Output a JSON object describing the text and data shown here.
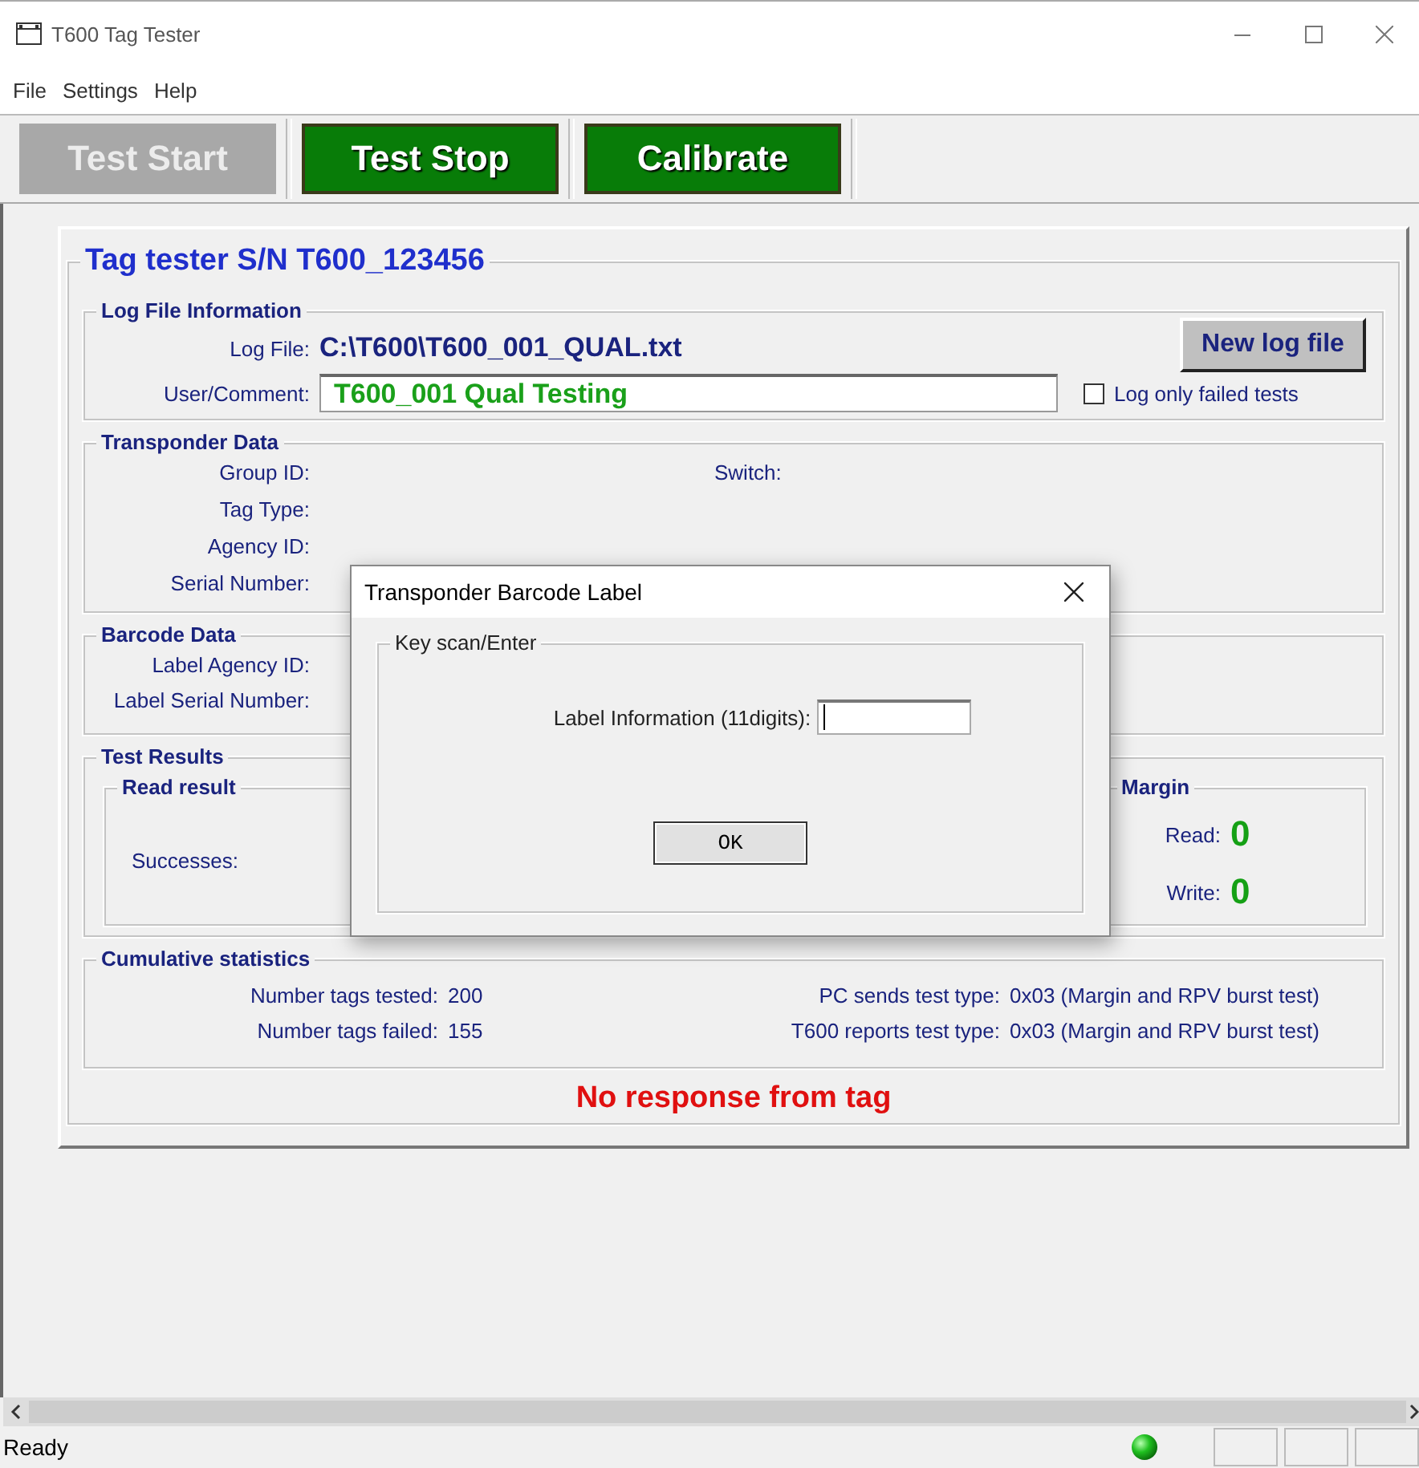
{
  "window": {
    "title": "T600 Tag Tester"
  },
  "menu": [
    "File",
    "Settings",
    "Help"
  ],
  "toolbar": [
    {
      "label": "Test Start",
      "disabled": true
    },
    {
      "label": "Test Stop",
      "disabled": false
    },
    {
      "label": "Calibrate",
      "disabled": false
    }
  ],
  "form": {
    "title": "Tag tester S/N T600_123456",
    "log_file_information": {
      "title": "Log File Information",
      "log_file_label": "Log File:",
      "log_file": "C:\\T600\\T600_001_QUAL.txt",
      "comment_label": "User/Comment:",
      "comment": "T600_001 Qual Testing",
      "new_log_button": "New log file",
      "log_only_failed": {
        "label": "Log only failed tests",
        "checked": false
      }
    },
    "transponder_data": {
      "title": "Transponder Data",
      "fields": [
        "Group ID:",
        "Tag Type:",
        "Agency ID:",
        "Serial Number:"
      ],
      "switch_label": "Switch:"
    },
    "barcode_data": {
      "title": "Barcode Data",
      "fields": [
        "Label Agency ID:",
        "Label Serial Number:"
      ]
    },
    "test_results": {
      "title": "Test Results",
      "read_result": {
        "title": "Read result",
        "successes_label": "Successes:"
      },
      "margin": {
        "title": "Margin",
        "rows": [
          {
            "label": "Read:",
            "value": "0"
          },
          {
            "label": "Write:",
            "value": "0"
          }
        ]
      }
    },
    "cumulative_statistics": {
      "title": "Cumulative statistics",
      "rows": [
        {
          "label": "Number tags tested:",
          "value": "200",
          "label_2": "PC sends test type:",
          "value_2": "0x03 (Margin and RPV burst test)"
        },
        {
          "label": "Number tags failed:",
          "value": "155",
          "label_2": "T600 reports test type:",
          "value_2": "0x03 (Margin and RPV burst test)"
        }
      ]
    },
    "message": "No response from tag"
  },
  "dialog": {
    "title": "Transponder Barcode Label",
    "group_title": "Key scan/Enter",
    "field_label": "Label Information (11digits):",
    "ok_button": "OK"
  },
  "status_bar": {
    "text": "Ready"
  }
}
